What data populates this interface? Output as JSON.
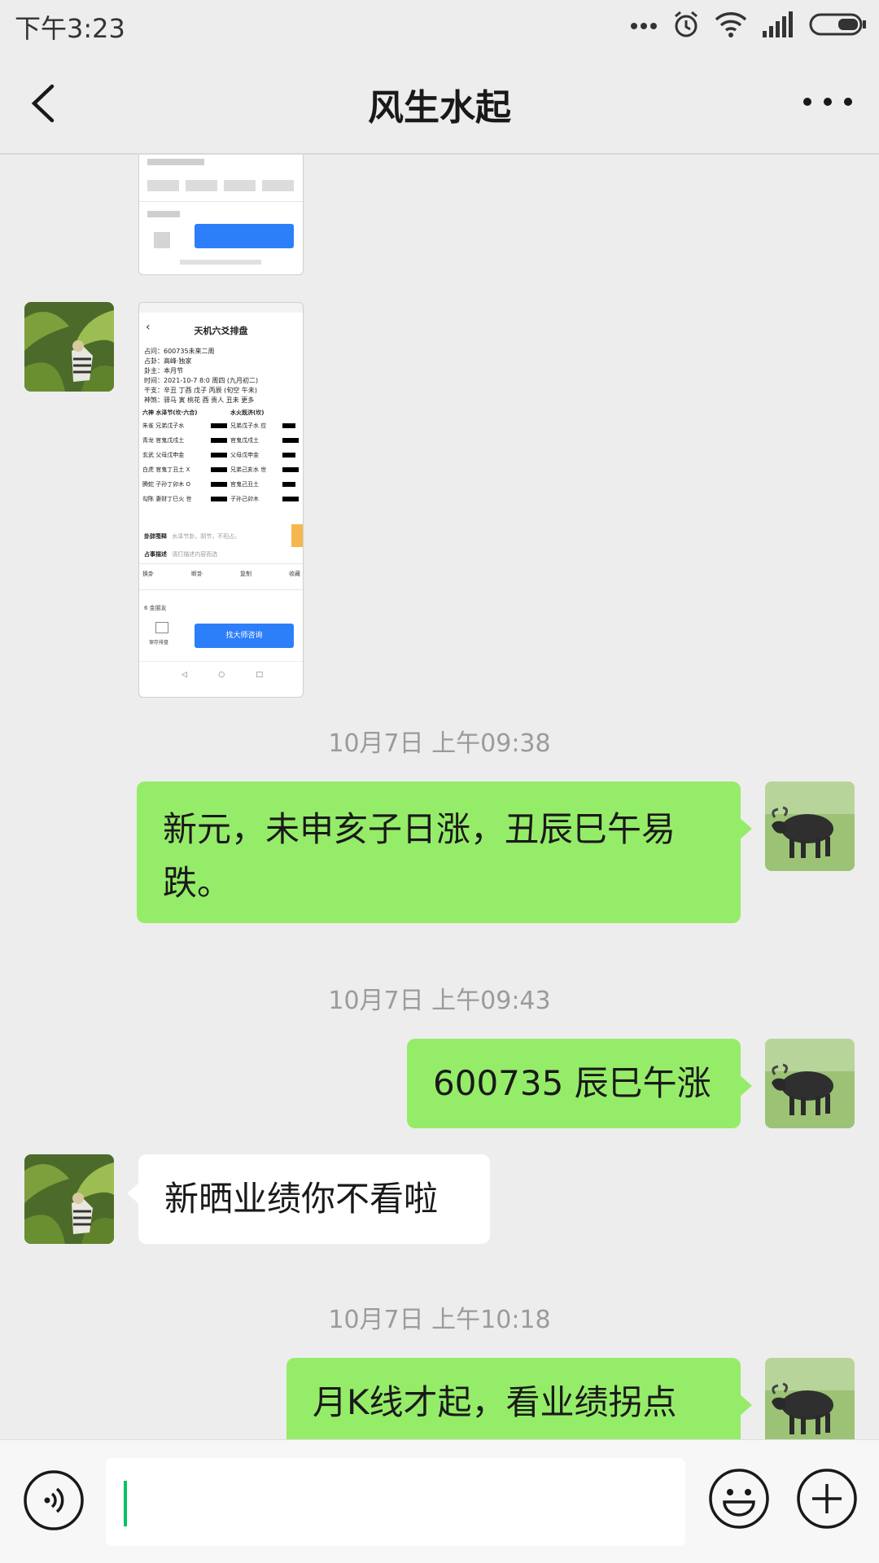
{
  "status_bar": {
    "time": "下午3:23",
    "icons": [
      "dots-icon",
      "alarm-icon",
      "wifi-icon",
      "signal-icon",
      "battery-icon"
    ]
  },
  "header": {
    "title": "风生水起",
    "back_icon": "chevron-left-icon",
    "more_icon": "more-dots-icon"
  },
  "screenshot_card": {
    "title": "天机六爻排盘",
    "lines": [
      "占问：600735未来二周",
      "占卦：高峰·独家",
      "卦主：本月节",
      "时间：2021-10-7 8:0 周四 (九月初二)",
      "干支：辛丑 丁酉 戊子 丙辰 (旬空 午未)",
      "神煞：驿马  寅  桃花  酉  贵人  丑未  更多"
    ],
    "hex_headers": [
      "六神  水泽节(坎·六合)",
      "水火既济(坎)"
    ],
    "hex_rows": [
      [
        "朱雀 兄弟戊子水",
        "兄弟戊子水 应"
      ],
      [
        "青龙 官鬼戊戌土",
        "官鬼戊戌土"
      ],
      [
        "玄武 父母戊申金",
        "父母戊申金"
      ],
      [
        "白虎 官鬼丁丑土 X",
        "兄弟己亥水 世"
      ],
      [
        "腾蛇 子孙丁卯木 O",
        "官鬼己丑土"
      ],
      [
        "勾陈 妻财丁巳火 世",
        "子孙己卯木"
      ]
    ],
    "note_label": "卦辞笺释",
    "note_text": "水泽节卦，阴节，不阳占。",
    "desc_label": "占事描述",
    "desc_text": "请打描述内容而选",
    "tool_labels": [
      "换卦",
      "断卦",
      "复制",
      "收藏"
    ],
    "footer_label": "6 金朋友",
    "save_label": "保存排盘",
    "action_label": "找大师咨询"
  },
  "messages": [
    {
      "type": "timestamp",
      "text": "10月7日 上午09:38"
    },
    {
      "type": "text",
      "from": "me",
      "text": "新元，未申亥子日涨，丑辰巳午易跌。"
    },
    {
      "type": "timestamp",
      "text": "10月7日 上午09:43"
    },
    {
      "type": "text",
      "from": "me",
      "text": "600735 辰巳午涨"
    },
    {
      "type": "text",
      "from": "other",
      "text": "新晒业绩你不看啦"
    },
    {
      "type": "timestamp",
      "text": "10月7日 上午10:18"
    },
    {
      "type": "text",
      "from": "me",
      "text": "月K线才起，看业绩拐点"
    }
  ],
  "input_bar": {
    "value": "",
    "voice_icon": "voice-icon",
    "emoji_icon": "emoji-icon",
    "plus_icon": "plus-icon"
  },
  "colors": {
    "background": "#ededed",
    "bubble_me": "#95ec69",
    "bubble_other": "#ffffff",
    "accent": "#2d7ff9",
    "caret": "#07c160"
  }
}
